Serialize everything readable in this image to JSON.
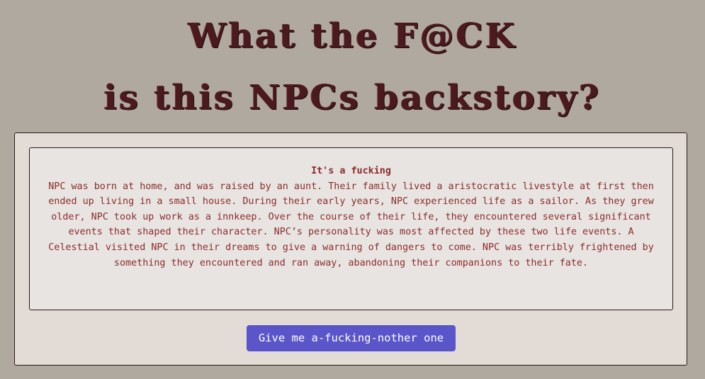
{
  "header": {
    "title_line_1": "What the F@CK",
    "title_line_2": "is this NPCs backstory?"
  },
  "story": {
    "heading": "It's a fucking",
    "text": "NPC was born at home, and was raised by an aunt. Their family lived a aristocratic livestyle at first then ended up living in a small house. During their early years, NPC experienced life as a sailor. As they grew older, NPC took up work as a innkeep. Over the course of their life, they encountered several significant events that shaped their character. NPC’s personality was most affected by these two life events. A Celestial visited NPC in their dreams to give a warning of dangers to come. NPC was terribly frightened by something they encountered and ran away, abandoning their companions to their fate."
  },
  "actions": {
    "generate_label": "Give me a-fucking-nother one"
  },
  "colors": {
    "background": "#b0a99f",
    "title": "#4a1a1f",
    "story_text": "#8b2c2c",
    "button": "#5a55c9"
  }
}
